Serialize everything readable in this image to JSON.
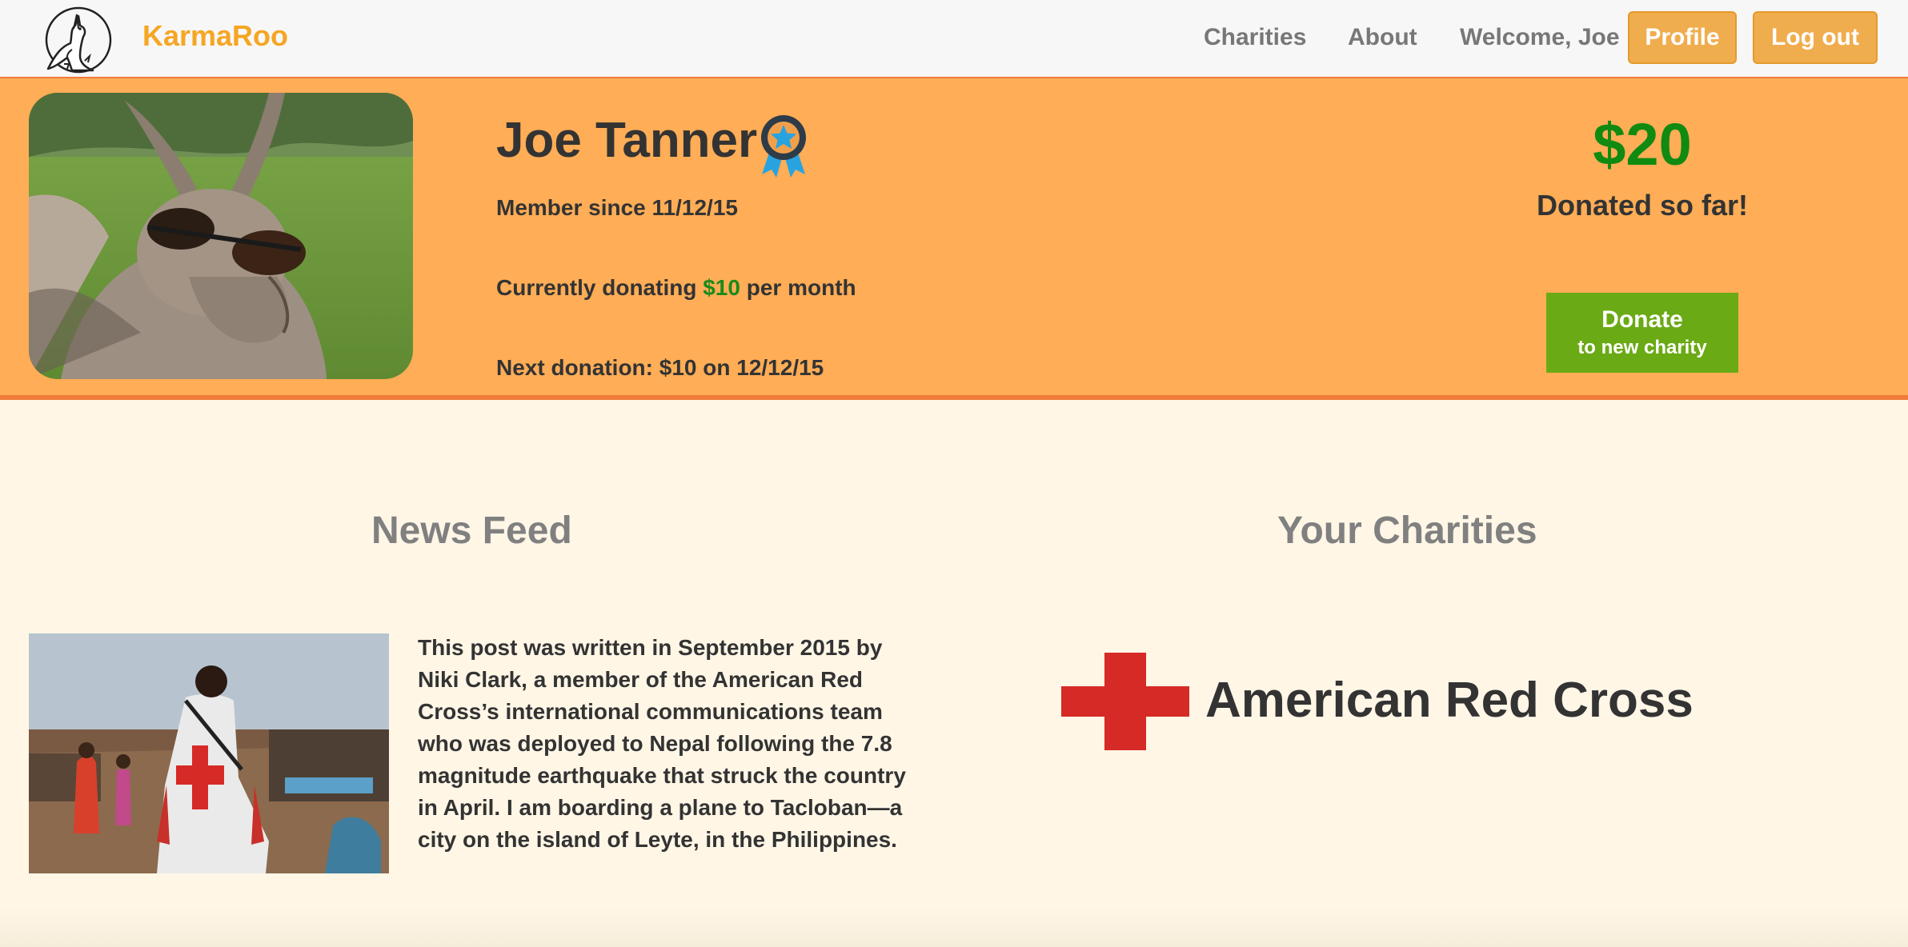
{
  "navbar": {
    "brand": "KarmaRoo",
    "links": {
      "charities": "Charities",
      "about": "About"
    },
    "welcome": "Welcome, Joe",
    "profile_label": "Profile",
    "logout_label": "Log out"
  },
  "profile": {
    "name": "Joe Tanner",
    "member_since": "Member since 11/12/15",
    "donating_prefix": "Currently donating ",
    "donating_amount": "$10",
    "donating_suffix": " per month",
    "next_donation": "Next donation: $10 on 12/12/15",
    "total_donated": "$20",
    "total_label": "Donated so far!",
    "donate_button": {
      "line1": "Donate",
      "line2": "to new charity"
    }
  },
  "news_feed": {
    "title": "News Feed",
    "posts": [
      {
        "text": "This post was written in September 2015 by Niki Clark, a member of the American Red Cross’s international communications team who was deployed to Nepal following the 7.8 magnitude earthquake that struck the country in April. I am boarding a plane to Tacloban—a city on the island of Leyte, in the Philippines."
      }
    ]
  },
  "your_charities": {
    "title": "Your Charities",
    "items": [
      {
        "name": "American Red Cross"
      }
    ]
  },
  "colors": {
    "brand": "#f5a623",
    "banner": "#ffad56",
    "accent_border": "#f07c3a",
    "donate_green": "#6aaa14",
    "money_green": "#118a11",
    "red_cross": "#d62a27",
    "page_bg": "#fff6e6"
  }
}
